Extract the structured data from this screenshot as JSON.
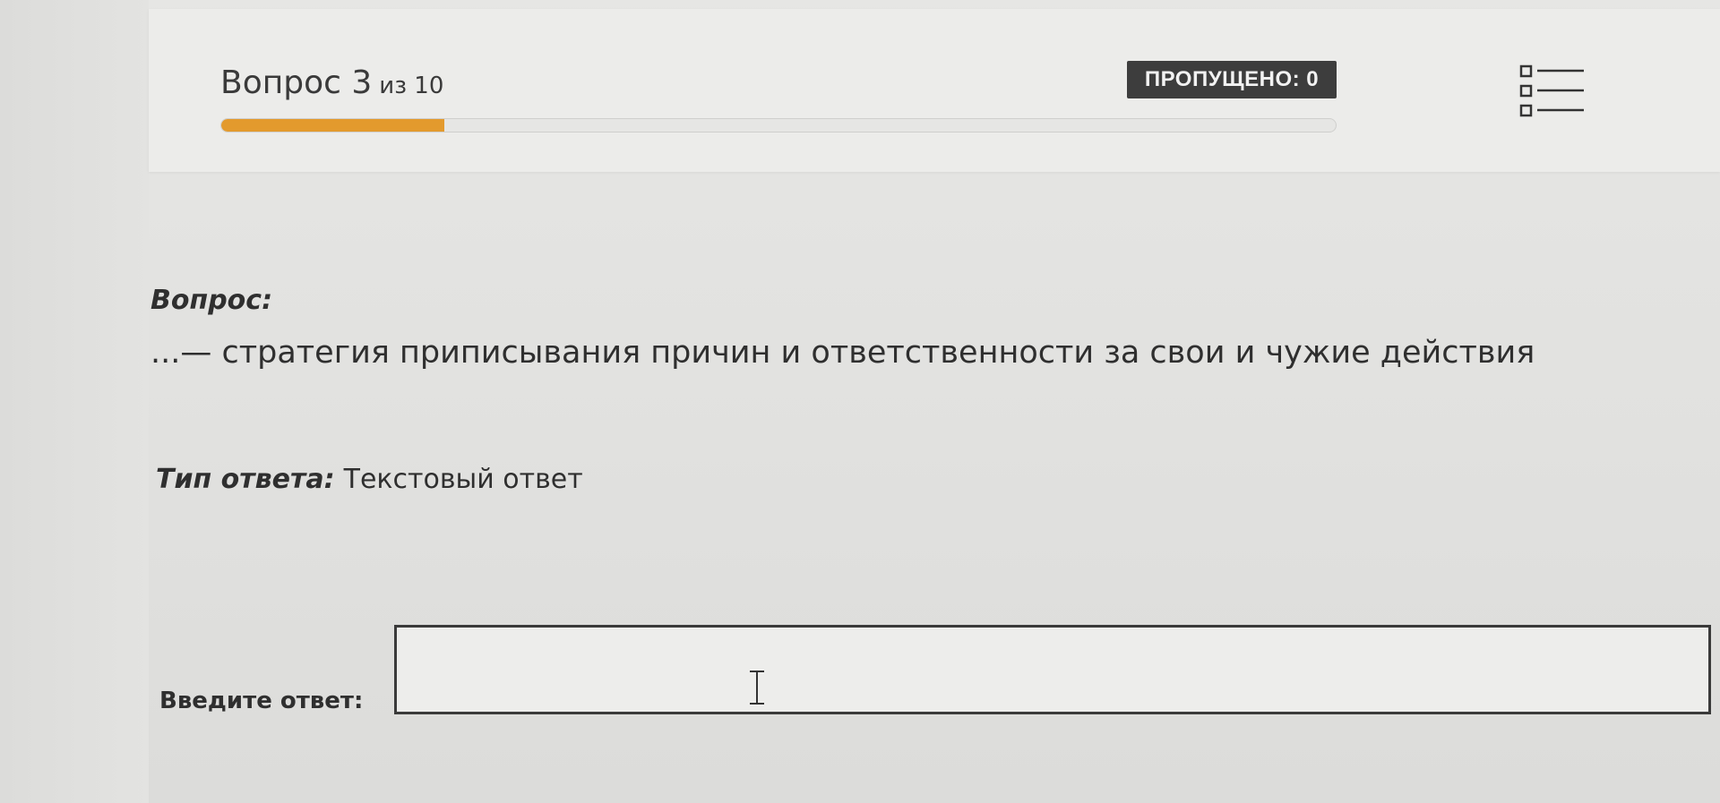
{
  "header": {
    "question_word": "Вопрос",
    "question_number": "3",
    "question_of": "из 10",
    "progress": 0.2,
    "skipped_label": "ПРОПУЩЕНО: 0",
    "progress_color": "#e39a2d"
  },
  "question": {
    "heading": "Вопрос:",
    "text": "...— стратегия приписывания причин и ответственности за свои и чужие действия"
  },
  "answer_type": {
    "label": "Тип ответа:",
    "value": "Текстовый ответ"
  },
  "answer": {
    "label": "Введите ответ:",
    "value": ""
  },
  "icons": {
    "question_list": "list-icon",
    "text_cursor": "text-cursor-icon"
  }
}
